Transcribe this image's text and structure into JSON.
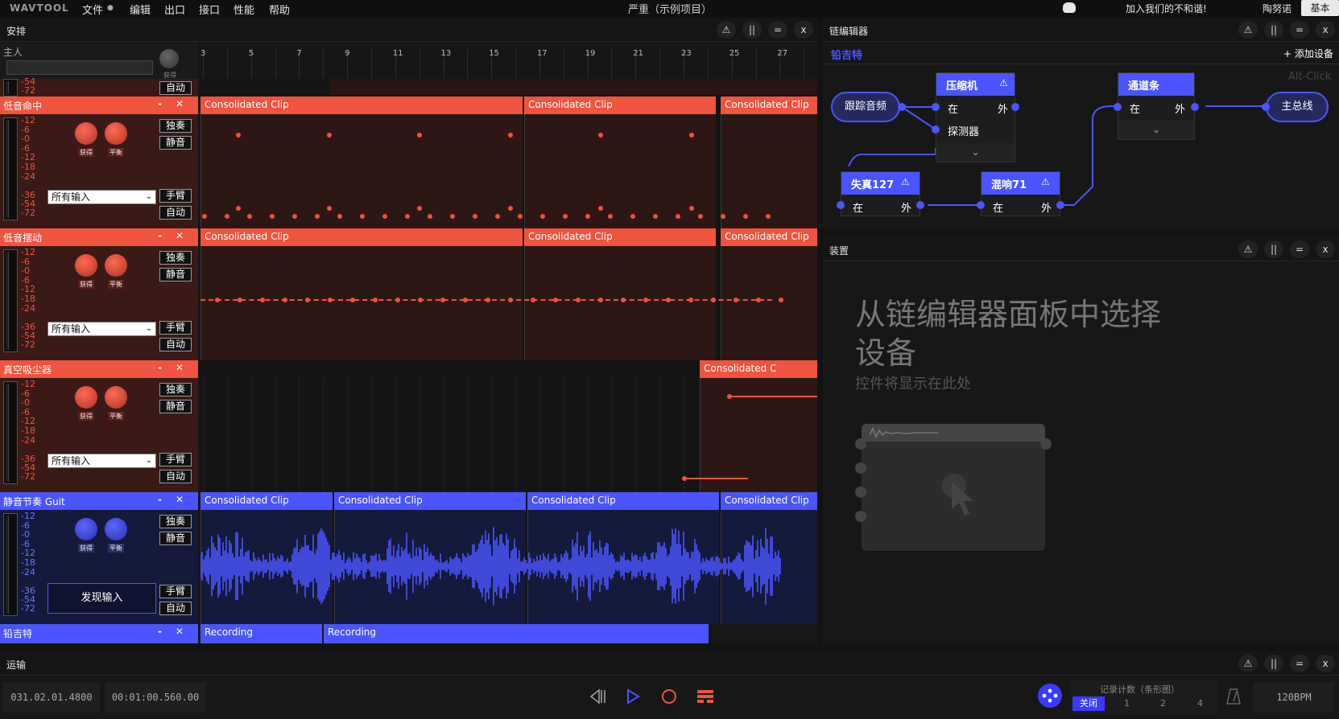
{
  "menubar": {
    "logo": "WAVTOOL",
    "items": [
      "文件",
      "编辑",
      "出口",
      "接口",
      "性能",
      "帮助"
    ],
    "file_dot": "●",
    "title": "严重（示例项目）",
    "discord_text": "加入我们的不和谐!",
    "user": "陶努诺",
    "mode": "基本"
  },
  "panel_buttons": {
    "a": "⚠",
    "b": "||",
    "c": "=",
    "d": "x"
  },
  "arrange": {
    "title": "安排",
    "master_label": "主人",
    "master_knob_label": "获得",
    "ruler": [
      "3",
      "5",
      "7",
      "9",
      "11",
      "13",
      "15",
      "17",
      "19",
      "21",
      "23",
      "25",
      "27"
    ],
    "meter_scale": [
      "-12",
      "-6",
      "-0",
      "-6",
      "-12",
      "-18",
      "-24",
      "-36",
      "-54",
      "-72"
    ],
    "partial_scale": [
      "-54",
      "-72"
    ],
    "auto_label": "自动",
    "solo_label": "独奏",
    "mute_label": "静音",
    "arm_label": "手臂",
    "gain_label": "获得",
    "pan_label": "平衡",
    "input_select": "所有输入",
    "discover_input": "发现输入",
    "minimize": "-",
    "close": "✕",
    "clip_name": "Consolidated Clip",
    "clip_name_short": "Consolidated C",
    "recording": "Recording",
    "page_indicator": "1",
    "tracks": [
      {
        "name": "低音命中",
        "color": "#f0533e"
      },
      {
        "name": "低音摆动",
        "color": "#f0533e"
      },
      {
        "name": "真空吸尘器",
        "color": "#f0533e"
      },
      {
        "name": "静音节奏 Guit",
        "color": "#4a55ff"
      },
      {
        "name": "铅吉特",
        "color": "#4a55ff"
      }
    ]
  },
  "chain": {
    "title": "链编辑器",
    "instrument": "铅吉特",
    "add_device": "+ 添加设备",
    "hint": "Alt-Click",
    "track_audio": "跟踪音频",
    "master_bus": "主总线",
    "in_label": "在",
    "out_label": "外",
    "detector_label": "探测器",
    "nodes": {
      "compressor": "压缩机",
      "channel_strip": "通道条",
      "distortion": "失真127",
      "reverb": "混响71"
    },
    "accent": "#4a55ff"
  },
  "devices": {
    "title": "装置",
    "empty_title_line1": "从链编辑器面板中选择",
    "empty_title_line2": "设备",
    "empty_sub": "控件将显示在此处"
  },
  "transport": {
    "title": "运输",
    "position": "031.02.01.4800",
    "time": "00:01:00.560.00",
    "count_in_label": "记录计数（条形图）",
    "count_off": "关闭",
    "count_options": [
      "1",
      "2",
      "4"
    ],
    "bpm": "120BPM"
  }
}
